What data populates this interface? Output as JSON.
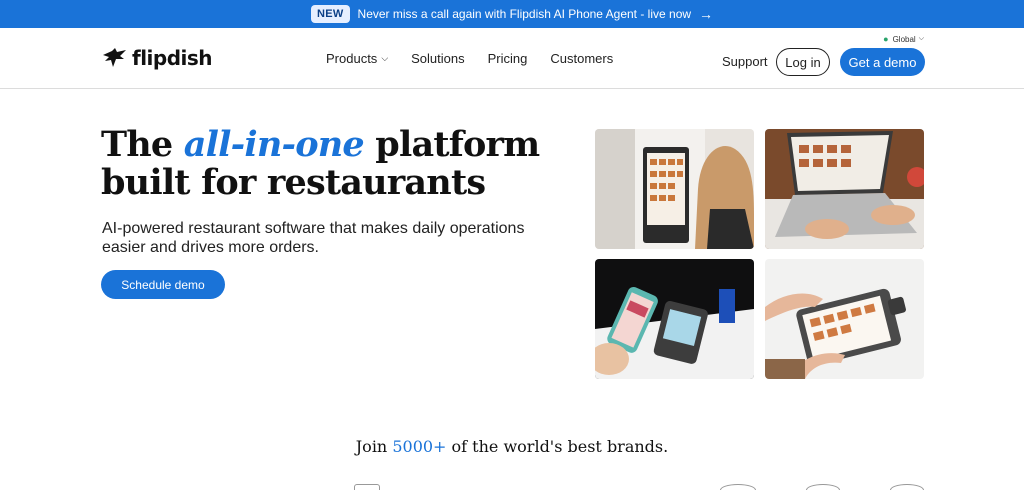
{
  "announcement": {
    "badge": "NEW",
    "text": "Never miss a call again with Flipdish AI Phone Agent - live now",
    "arrow": "→"
  },
  "header": {
    "brand": "flipdish",
    "nav": [
      {
        "label": "Products",
        "has_dropdown": true
      },
      {
        "label": "Solutions",
        "has_dropdown": false
      },
      {
        "label": "Pricing",
        "has_dropdown": false
      },
      {
        "label": "Customers",
        "has_dropdown": false
      }
    ],
    "region": "Global",
    "support": "Support",
    "login": "Log in",
    "cta": "Get a demo"
  },
  "hero": {
    "title_pre": "The ",
    "title_accent": "all-in-one",
    "title_post": " platform built for restaurants",
    "subtitle": "AI-powered restaurant software that makes daily operations easier and drives more orders.",
    "cta": "Schedule demo"
  },
  "brands": {
    "pre": "Join ",
    "count": "5000+",
    "post": " of the world's best brands."
  },
  "colors": {
    "accent": "#1a73d8",
    "text": "#111111"
  }
}
